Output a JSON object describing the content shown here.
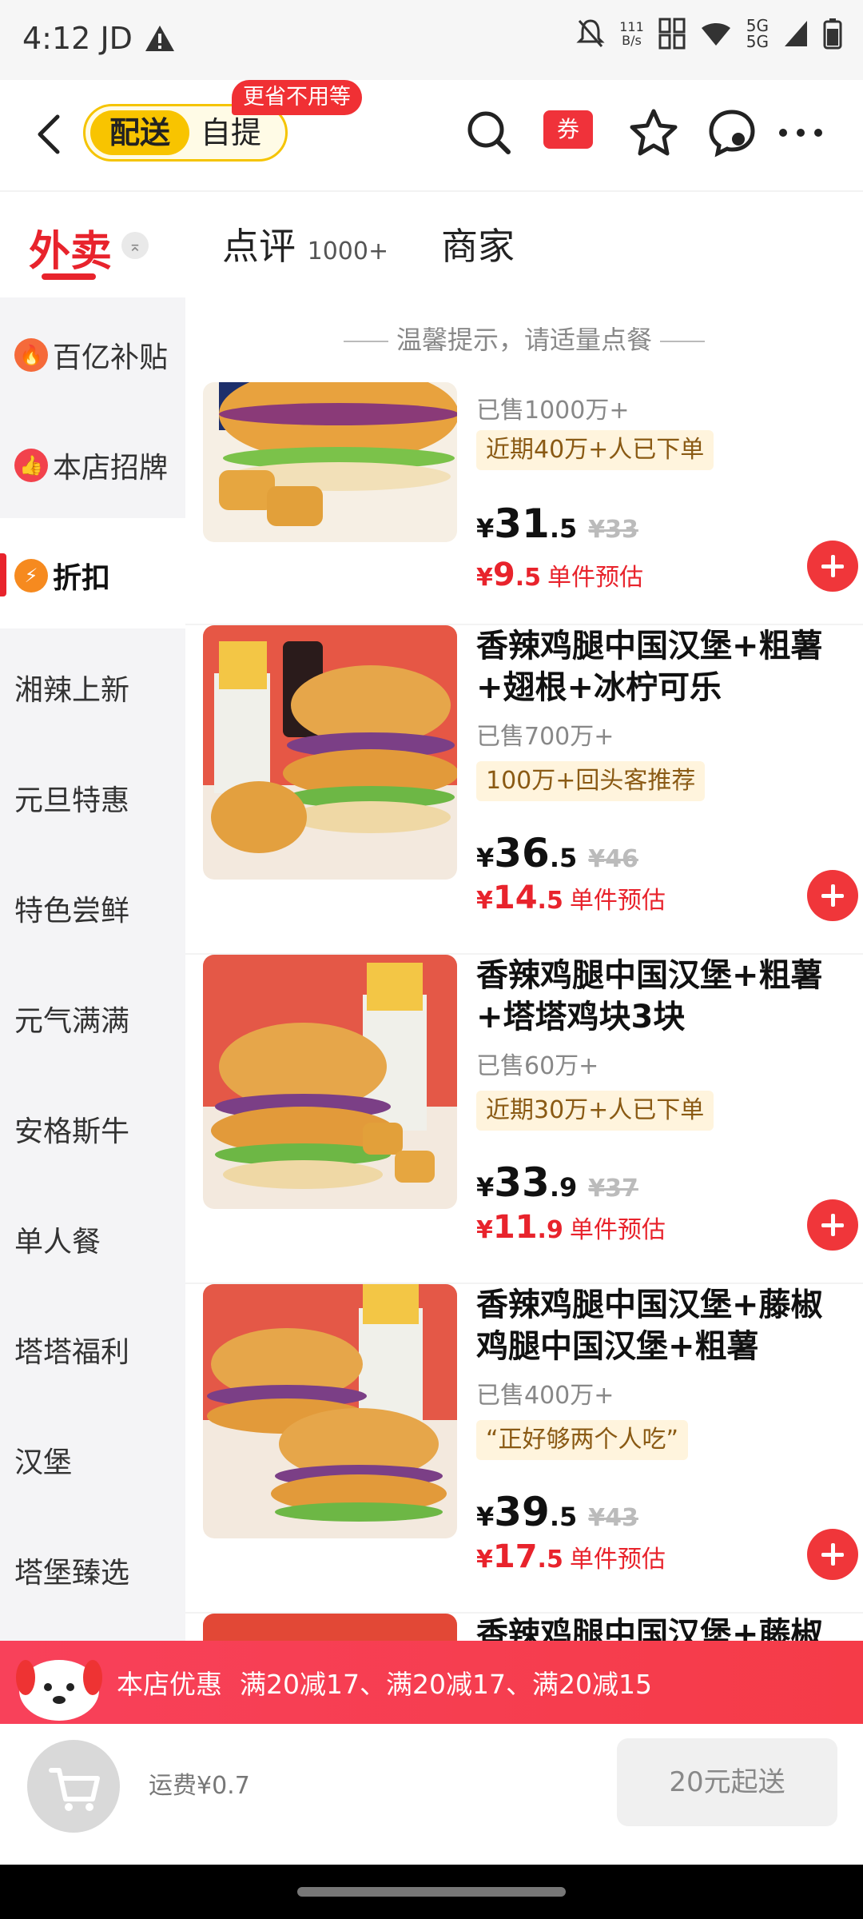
{
  "status_bar": {
    "time": "4:12",
    "carrier": "JD",
    "net_speed_value": "111",
    "net_speed_unit": "B/s",
    "network_top": "5G",
    "network_bottom": "5G"
  },
  "header": {
    "mode_delivery": "配送",
    "mode_pickup": "自提",
    "promo_tag": "更省不用等",
    "coupon_label": "券"
  },
  "tabs": {
    "takeout": "外卖",
    "takeout_badge": "⌅",
    "reviews": "点评",
    "reviews_count": "1000+",
    "merchant": "商家"
  },
  "sidebar": {
    "items": [
      {
        "label": "百亿补贴",
        "icon": "fire-icon"
      },
      {
        "label": "本店招牌",
        "icon": "thumbs-up-icon"
      },
      {
        "label": "折扣",
        "icon": "discount-icon"
      },
      {
        "label": "湘辣上新"
      },
      {
        "label": "元旦特惠"
      },
      {
        "label": "特色尝鲜"
      },
      {
        "label": "元气满满"
      },
      {
        "label": "安格斯牛"
      },
      {
        "label": "单人餐"
      },
      {
        "label": "塔塔福利"
      },
      {
        "label": "汉堡"
      },
      {
        "label": "塔堡臻选"
      }
    ]
  },
  "content": {
    "tip": "温馨提示，请适量点餐",
    "items": [
      {
        "name": "",
        "sold": "已售1000万+",
        "tag": "近期40万+人已下单",
        "price_currency": "¥",
        "price_int": "31",
        "price_dec": ".5",
        "orig_price": "¥33",
        "unit_currency": "¥",
        "unit_int": "9",
        "unit_dec": ".5",
        "unit_label": "单件预估"
      },
      {
        "name": "香辣鸡腿中国汉堡+粗薯+翅根+冰柠可乐",
        "sold": "已售700万+",
        "tag": "100万+回头客推荐",
        "price_currency": "¥",
        "price_int": "36",
        "price_dec": ".5",
        "orig_price": "¥46",
        "unit_currency": "¥",
        "unit_int": "14",
        "unit_dec": ".5",
        "unit_label": "单件预估"
      },
      {
        "name": "香辣鸡腿中国汉堡+粗薯+塔塔鸡块3块",
        "sold": "已售60万+",
        "tag": "近期30万+人已下单",
        "price_currency": "¥",
        "price_int": "33",
        "price_dec": ".9",
        "orig_price": "¥37",
        "unit_currency": "¥",
        "unit_int": "11",
        "unit_dec": ".9",
        "unit_label": "单件预估"
      },
      {
        "name": "香辣鸡腿中国汉堡+藤椒鸡腿中国汉堡+粗薯",
        "sold": "已售400万+",
        "tag": "“正好够两个人吃”",
        "price_currency": "¥",
        "price_int": "39",
        "price_dec": ".5",
        "orig_price": "¥43",
        "unit_currency": "¥",
        "unit_int": "17",
        "unit_dec": ".5",
        "unit_label": "单件预估"
      },
      {
        "name": "香辣鸡腿中国汉堡+藤椒"
      }
    ]
  },
  "banner": {
    "title": "本店优惠",
    "offers": "满20减17、满20减17、满20减15"
  },
  "bottom_bar": {
    "delivery_fee": "运费¥0.7",
    "min_order": "20元起送"
  },
  "colors": {
    "accent_red": "#e8232c",
    "delivery_yellow": "#f8c400",
    "tag_bg": "#fff4dd"
  }
}
